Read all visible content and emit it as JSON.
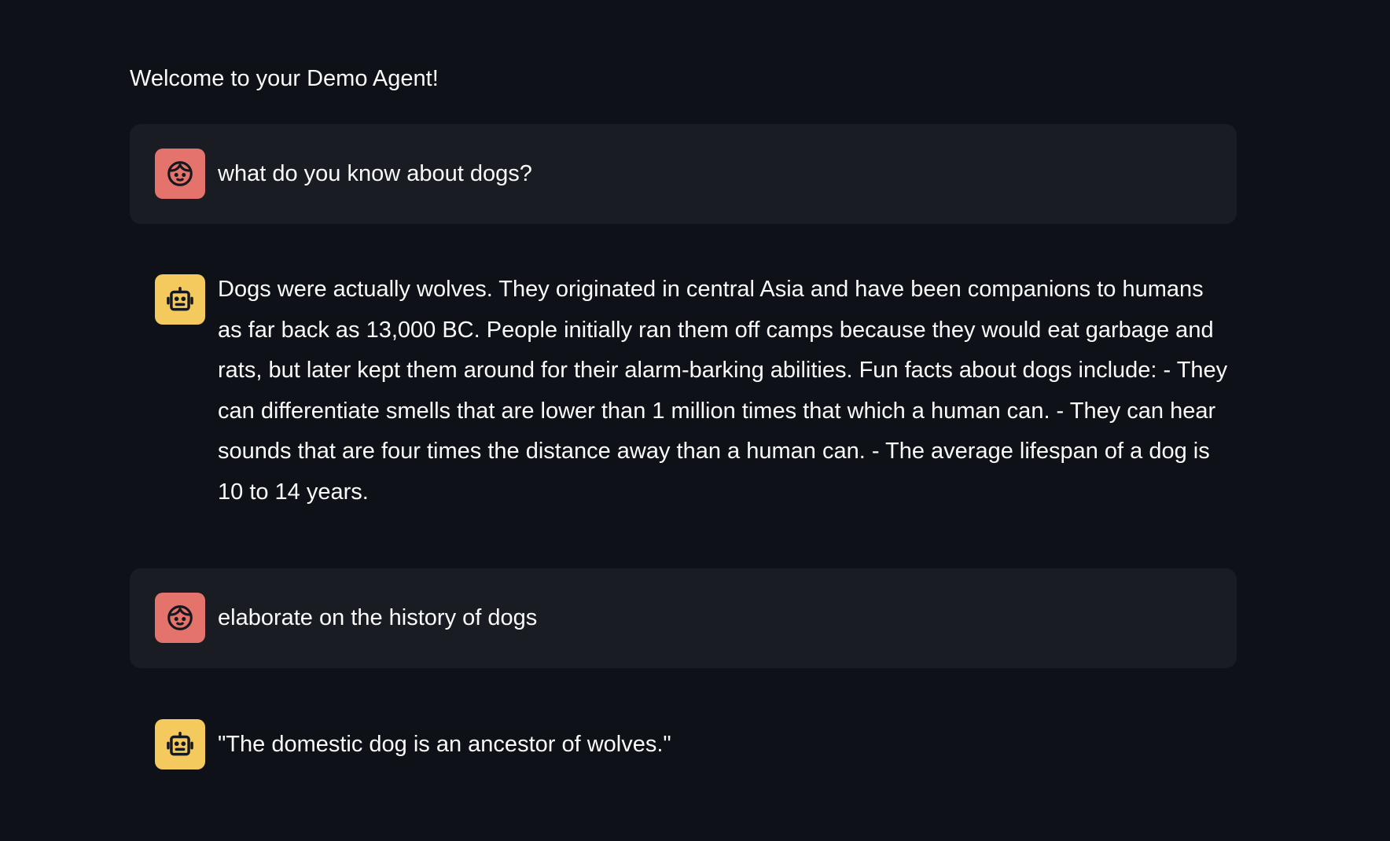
{
  "welcome": "Welcome to your Demo Agent!",
  "messages": [
    {
      "role": "user",
      "avatar": "user-face-icon",
      "text": "what do you know about dogs?"
    },
    {
      "role": "assistant",
      "avatar": "robot-icon",
      "text": "Dogs were actually wolves. They originated in central Asia and have been companions to humans as far back as 13,000 BC. People initially ran them off camps because they would eat garbage and rats, but later kept them around for their alarm-barking abilities. Fun facts about dogs include: - They can differentiate smells that are lower than 1 million times that which a human can. - They can hear sounds that are four times the distance away than a human can. - The average lifespan of a dog is 10 to 14 years."
    },
    {
      "role": "user",
      "avatar": "user-face-icon",
      "text": "elaborate on the history of dogs"
    },
    {
      "role": "assistant",
      "avatar": "robot-icon",
      "text": "\"The domestic dog is an ancestor of wolves.\""
    }
  ],
  "colors": {
    "background": "#0e1117",
    "user_message_bg": "#1a1c24",
    "user_avatar": "#e4736c",
    "assistant_avatar": "#f4c95d",
    "text": "#fafafa"
  }
}
